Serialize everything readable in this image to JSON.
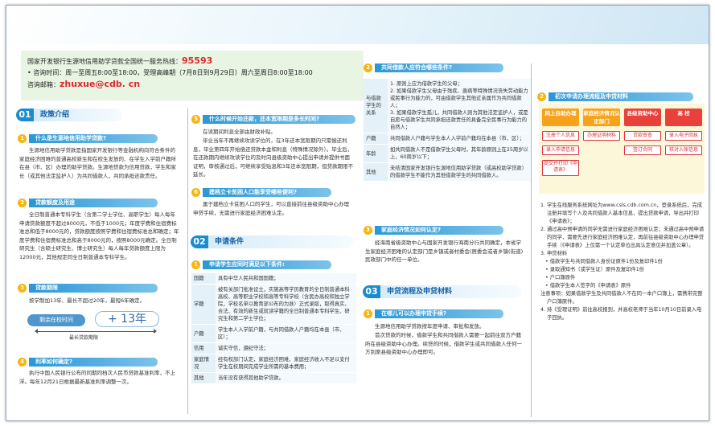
{
  "hotline": {
    "line1": "国家开发银行生源地信用助学贷款全国统一服务热线：",
    "phone": "95593",
    "line2": "• 咨询时间：周一至周五8:00至18:00，受理高峰期（7月8日到9月29日）周六至周日8:00至18:00",
    "mail_label": "咨询邮箱：",
    "mail": "zhuxue@cdb. cn"
  },
  "s1": {
    "num": "01",
    "title": "政策介绍"
  },
  "s1a": {
    "num": "1",
    "title": "什么是生源地信用助学贷款?",
    "text": "生源地信用助学贷款是指国家开发银行等金融机构向符合条件的家庭经济困难的普通高校新生和在校生发放的、在学生入学前户籍所在县（市、区）办理的助学贷款。生源地贷款为信用贷款，学生和家长（或其他法定监护人）为共同借款人，共同承担还款责任。"
  },
  "s1b": {
    "num": "2",
    "title": "贷款额度及用途",
    "text": "全日制普通本专科学生（含第二学士学位、高职学生）每人每年申请贷款额度不超过8000元，不低于1000元；年度学费和住宿费标准总和低于8000元的，贷款额度按照学费和住宿费标准总和确定；年度学费和住宿费标准总和高于8000元的，按照8000元确定。全日制研究生（含硕士研究生、博士研究生）每人每年贷款额度上限为12000元，其他规定同全日制普通本专科学生。"
  },
  "s1c": {
    "num": "3",
    "title": "贷款期限",
    "text": "按学制加13年、最长不超过20年，最短6年确定。",
    "pill": "剩余在校时间",
    "plus": "+  13年",
    "range": "最长贷款期限"
  },
  "s1d": {
    "num": "4",
    "title": "利率如何确定?",
    "text": "执行中国人民银行公布的同期同档次人民币贷款基准利率，不上浮。每年12月21日根据最新基准利率调整一次。"
  },
  "s2a": {
    "num": "5",
    "title": "什么时候开始还款，还本宽限期是多长时间?",
    "text": "在读期间利息全部由财政补贴。",
    "text2": "毕业当年不再继续攻读学位的，在3年还本宽限期内只需偿还利息，毕业第四年开始偿还贷款本金和利息（特殊情况除外）。毕业后，在还款期内继续攻读学位的及时向县级资助中心提出申请并提供书面证明，审核通过后，可继续享受贴息和3年还本宽限期，但贷款期限不延长。"
  },
  "s2b": {
    "num": "6",
    "title": "建档立卡贫困人口能享受哪些便利?",
    "text": "属于建档立卡贫困人口的学生，可以直接前往县级资助中心办理申贷手续，无需进行家庭经济困难认定。"
  },
  "s2": {
    "num": "02",
    "title": "申请条件"
  },
  "s2c": {
    "num": "1",
    "title": "申请学生应同时满足以下条件:"
  },
  "cond": [
    {
      "h": "国籍",
      "v": "具有中华人民共和国国籍；"
    },
    {
      "h": "学籍",
      "v": "被有关部门批准设立，实施高等学历教育的全日制普通本科高校、高等职业学校和高等专科学校（含民办高校和独立学院，学校名单以教育部公布的为准）正式录取，取得真实、合法、有效的新生或就读学籍的全日制普通本专科学生、研究生和第二学士学位；"
    },
    {
      "h": "户籍",
      "v": "学生本人入学前户籍，与共同借款人户籍均在本县（市、区）；"
    },
    {
      "h": "信用",
      "v": "诚实守信，遵纪守法；"
    },
    {
      "h": "家庭情况",
      "v": "经有权部门认定，家庭经济困难、家庭经济收入不足以支付学生在校期间完成学业所需的基本费用；"
    },
    {
      "h": "其他",
      "v": "当年没有获得其他助学贷款。"
    }
  ],
  "s3a": {
    "num": "2",
    "title": "共同借款人应符合哪些条件?"
  },
  "bor": [
    {
      "h": "与借款学生的关系",
      "v": "1. 原则上应为借款学生的父母；\n2. 如果借款学生父母由于残疾、患病等特殊情况丧失劳动能力或民事行为能力的，可由借款学生其他近亲属作为共同借款人；\n3. 如果借款学生孤儿，共同借款人则为其他法定监护人，或是自愿与借款学生共同承担还款责任的具备完全民事行为能力的自然人；"
    },
    {
      "h": "户籍",
      "v": "共同借款人户籍与学生本人入学前户籍均在本县（市、区）；"
    },
    {
      "h": "年龄",
      "v": "如共同借款人不是借款学生父母时，其年龄原则上在25周岁以上，60周岁以下；"
    },
    {
      "h": "其他",
      "v": "未结清国家开发银行生源地信用助学贷款（或高校助学贷款）的借款学生不能作为其他借款学生的共同借款人。"
    }
  ],
  "s3b": {
    "num": "3",
    "title": "家庭经济情况如何认定?",
    "text": "经海南省级资助中心与国家开发银行海南分行共同确定，本省学生家庭经济困难的认定部门是乡镇或者村委会(居委会或者乡镇(街道)民政部门中的任一单位。"
  },
  "s3": {
    "num": "03",
    "title": "申贷流程及申贷材料"
  },
  "s3c": {
    "num": "1",
    "title": "在哪儿可以办理申贷手续?",
    "text": "生源地信用助学贷款按年度申请、审批和发放。",
    "text2": "首次贷款的时候，借款学生和共同借款人需要一起前往双方户籍所在县级资助中心办理。续贷的时候，借款学生或共同借款人任何一方到原县级资助中心办理即可。"
  },
  "s4a": {
    "num": "2",
    "title": "初次申请办理流程及申贷材料"
  },
  "flow": [
    {
      "head": "网上自助办理",
      "color": "#f7a21b",
      "items": [
        "注册个人信息",
        "录入申请信息",
        "提交并打印《申请表》"
      ]
    },
    {
      "head": "家庭经济情况认定部门",
      "color": "#f7a21b",
      "items": [
        "办理证明材料"
      ]
    },
    {
      "head": "县级资助中心",
      "color": "#e8403a",
      "items": [
        "贷款审查",
        "签订合同"
      ]
    },
    {
      "head": "高  校",
      "color": "#e8403a",
      "items": [
        "录入电子回执",
        "核对入账信息"
      ]
    }
  ],
  "steps": [
    "1. 学生在线服务系统网址为www.csls.cdb.com.cn，登录系统后，完成注册并填写个人及共同借款人基本信息，提出贷款申请，导出并打印《申请表》；",
    "2. 通过高中预申请的同学无需进行家庭经济困难认定；未通过高中预申请的同学，需要先进行家庭经济困难认定，再前往县级资助中心办理申贷手续（《申请表》上仅需一个认定单位出具认定意见并加盖公章）。",
    "3. 申贷材料",
    "• 借款学生与共同借款人身份证原件1份及复印件1份",
    "• 录取通知书（或学生证）原件及复印件1份",
    "• 户口簿原件",
    "• 借款学生本人签字的《申请表》原件",
    "注意事项：如果借款学生及共同借款人不在同一本户口簿上，需携带完整户口簿原件。",
    "4. 持《受理证明》前往高校报到，并高校老师于当年10月10日前录入电子回执。"
  ]
}
